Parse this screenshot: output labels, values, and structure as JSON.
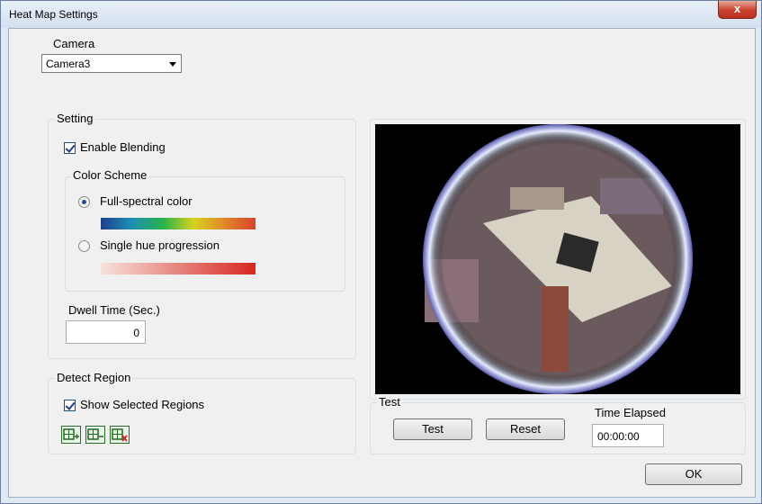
{
  "window": {
    "title": "Heat Map Settings",
    "close_label": "x"
  },
  "camera": {
    "label": "Camera",
    "selected": "Camera3"
  },
  "setting": {
    "group_label": "Setting",
    "enable_blending_label": "Enable Blending",
    "enable_blending_checked": true,
    "color_scheme": {
      "group_label": "Color Scheme",
      "options": [
        {
          "label": "Full-spectral color",
          "selected": true
        },
        {
          "label": "Single hue progression",
          "selected": false
        }
      ]
    },
    "dwell_time_label": "Dwell Time (Sec.)",
    "dwell_time_value": "0"
  },
  "detect_region": {
    "group_label": "Detect Region",
    "show_selected_label": "Show Selected Regions",
    "show_selected_checked": true,
    "tools": [
      "add-region-icon",
      "remove-region-icon",
      "clear-regions-icon"
    ]
  },
  "test": {
    "group_label": "Test",
    "test_button": "Test",
    "reset_button": "Reset",
    "time_elapsed_label": "Time Elapsed",
    "time_elapsed_value": "00:00:00"
  },
  "ok_button": "OK",
  "colors": {
    "spectral": [
      "#1c3f8f",
      "#1d8fb3",
      "#27b34a",
      "#d8d21f",
      "#e0872a",
      "#d9432b"
    ],
    "single_hue": [
      "#f7e2dc",
      "#d6271f"
    ]
  }
}
